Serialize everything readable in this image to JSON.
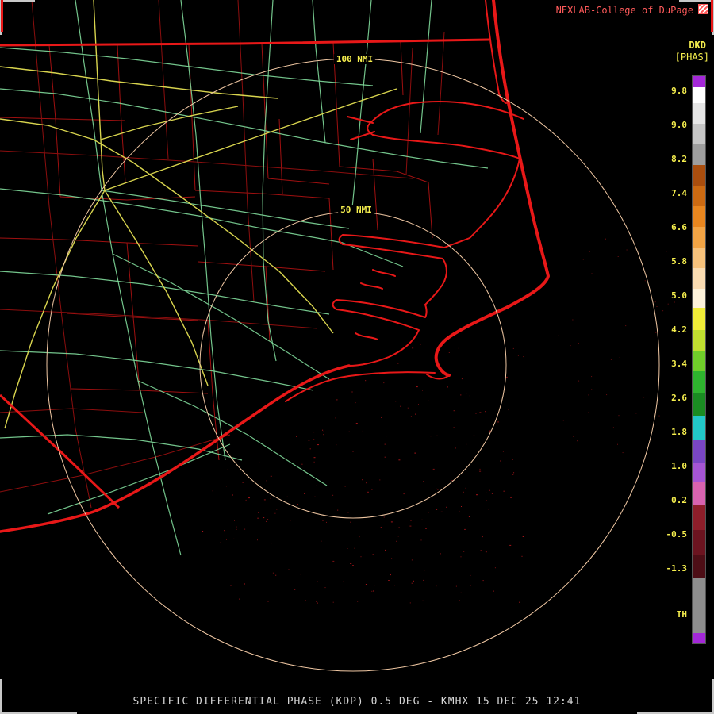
{
  "palette": {
    "bg": "#000000",
    "coast": "#e81818",
    "county": "#a01010",
    "thinred": "#8c0e0e",
    "road-green": "#7fd99a",
    "road-yellow": "#d8d44e",
    "ring": "#f2c9a4",
    "label-yellow": "#f6ef4e",
    "header-red": "#ff5a5a",
    "caption-gray": "#d6d6d6",
    "corner-gray": "#c8c8c8",
    "speckle": "#8f1114"
  },
  "header": {
    "source_label": "NEXLAB-College of DuPage",
    "logo_icon": "cod-logo",
    "product_code": "DKD",
    "product_units": "[PHAS]"
  },
  "range_rings": {
    "outer_label": "100 NMI",
    "inner_label": "50 NMI"
  },
  "colorbar": {
    "ticks": [
      "9.8",
      "9.0",
      "8.2",
      "7.4",
      "6.6",
      "5.8",
      "5.0",
      "4.2",
      "3.4",
      "2.6",
      "1.8",
      "1.0",
      "0.2",
      "-0.5",
      "-1.3",
      "TH"
    ],
    "segments": [
      {
        "color": "#a428d8",
        "h": 14
      },
      {
        "color": "#ffffff",
        "h": 20
      },
      {
        "color": "#e6e6e6",
        "h": 26
      },
      {
        "color": "#c6c6c6",
        "h": 26
      },
      {
        "color": "#9e9e9e",
        "h": 26
      },
      {
        "color": "#aa4e0e",
        "h": 26
      },
      {
        "color": "#cc6a12",
        "h": 26
      },
      {
        "color": "#e8861f",
        "h": 26
      },
      {
        "color": "#f2a445",
        "h": 26
      },
      {
        "color": "#f7c27c",
        "h": 26
      },
      {
        "color": "#fadcb2",
        "h": 26
      },
      {
        "color": "#fdf2da",
        "h": 24
      },
      {
        "color": "#f0ec38",
        "h": 28
      },
      {
        "color": "#c0df30",
        "h": 26
      },
      {
        "color": "#70ce2a",
        "h": 26
      },
      {
        "color": "#2eb42e",
        "h": 28
      },
      {
        "color": "#1a8c22",
        "h": 28
      },
      {
        "color": "#22c8c8",
        "h": 30
      },
      {
        "color": "#7a46c4",
        "h": 30
      },
      {
        "color": "#a655d4",
        "h": 24
      },
      {
        "color": "#d863b0",
        "h": 28
      },
      {
        "color": "#8e1e2a",
        "h": 32
      },
      {
        "color": "#6c1420",
        "h": 32
      },
      {
        "color": "#4e0e16",
        "h": 28
      },
      {
        "color": "#8e8e8e",
        "h": 70
      },
      {
        "color": "#a428d8",
        "h": 13
      }
    ]
  },
  "footer": {
    "caption": "SPECIFIC DIFFERENTIAL PHASE (KDP) 0.5 DEG - KMHX 15 DEC 25 12:41"
  }
}
